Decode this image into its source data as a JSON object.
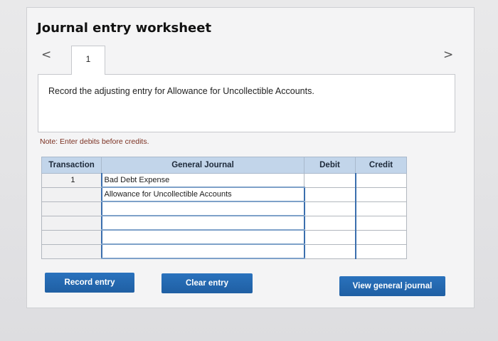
{
  "worksheet": {
    "title": "Journal entry worksheet",
    "nav_prev": "<",
    "nav_next": ">",
    "tab_label": "1",
    "instruction": "Record the adjusting entry for Allowance for Uncollectible Accounts.",
    "note": "Note: Enter debits before credits."
  },
  "table": {
    "headers": {
      "transaction": "Transaction",
      "general_journal": "General Journal",
      "debit": "Debit",
      "credit": "Credit"
    },
    "rows": [
      {
        "transaction": "1",
        "account": "Bad Debt Expense",
        "debit": "",
        "credit": ""
      },
      {
        "transaction": "",
        "account": "Allowance for Uncollectible Accounts",
        "debit": "",
        "credit": ""
      },
      {
        "transaction": "",
        "account": "",
        "debit": "",
        "credit": ""
      },
      {
        "transaction": "",
        "account": "",
        "debit": "",
        "credit": ""
      },
      {
        "transaction": "",
        "account": "",
        "debit": "",
        "credit": ""
      },
      {
        "transaction": "",
        "account": "",
        "debit": "",
        "credit": ""
      }
    ]
  },
  "buttons": {
    "record": "Record entry",
    "clear": "Clear entry",
    "view": "View general journal"
  }
}
